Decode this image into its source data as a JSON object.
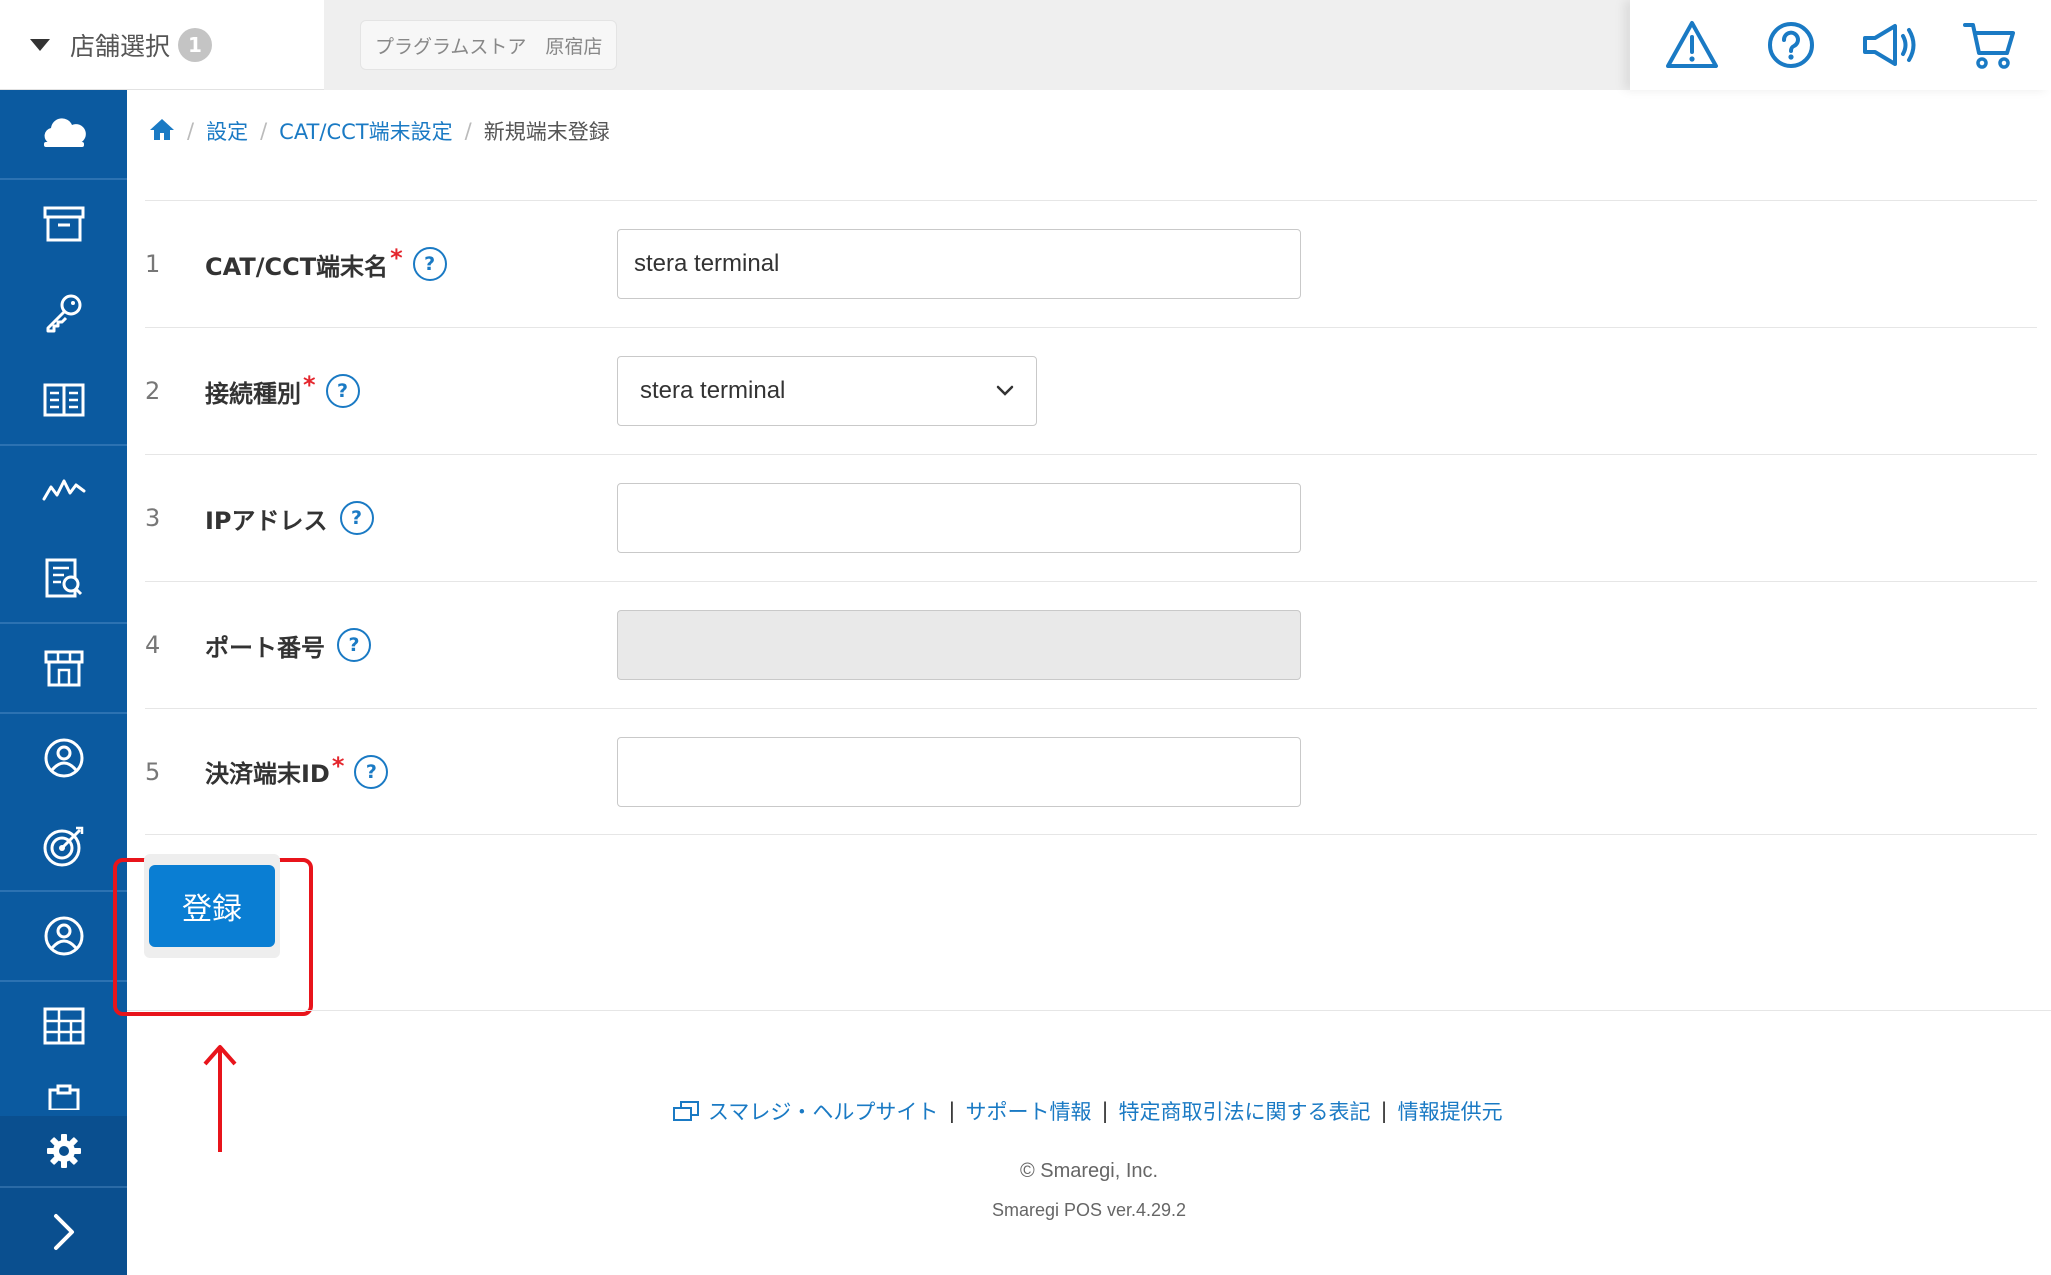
{
  "header": {
    "store_select_label": "店舗選択",
    "store_count": "1",
    "current_store": "プラグラムストア　原宿店",
    "icons": [
      "warning-icon",
      "help-icon",
      "announcement-icon",
      "cart-icon"
    ]
  },
  "sidebar": {
    "items": [
      "cloud-icon",
      "archive-icon",
      "key-icon",
      "book-icon",
      "analytics-icon",
      "report-icon",
      "store-icon",
      "customer-icon",
      "target-icon",
      "staff-icon",
      "layout-icon",
      "clipboard-icon"
    ],
    "settings_icon": "gear-icon",
    "expand_icon": "chevron-right-icon"
  },
  "breadcrumb": {
    "home_icon": "home-icon",
    "items": [
      "設定",
      "CAT/CCT端末設定",
      "新規端末登録"
    ]
  },
  "form": {
    "rows": [
      {
        "num": "1",
        "label": "CAT/CCT端末名",
        "required": "*",
        "value": "stera terminal"
      },
      {
        "num": "2",
        "label": "接続種別",
        "required": "*",
        "value": "stera terminal"
      },
      {
        "num": "3",
        "label": "IPアドレス",
        "required": "",
        "value": ""
      },
      {
        "num": "4",
        "label": "ポート番号",
        "required": "",
        "value": ""
      },
      {
        "num": "5",
        "label": "決済端末ID",
        "required": "*",
        "value": ""
      }
    ],
    "help_glyph": "?",
    "submit_label": "登録"
  },
  "footer": {
    "links": [
      "スマレジ・ヘルプサイト",
      "サポート情報",
      "特定商取引法に関する表記",
      "情報提供元"
    ],
    "separator": "|",
    "copyright": "© Smaregi, Inc.",
    "version": "Smaregi POS ver.4.29.2"
  },
  "colors": {
    "sidebar": "#0b5aa0",
    "accent": "#1a7ac4",
    "primary_button": "#0a7ed3",
    "required": "#e4262d",
    "annotation": "#e8141b"
  }
}
